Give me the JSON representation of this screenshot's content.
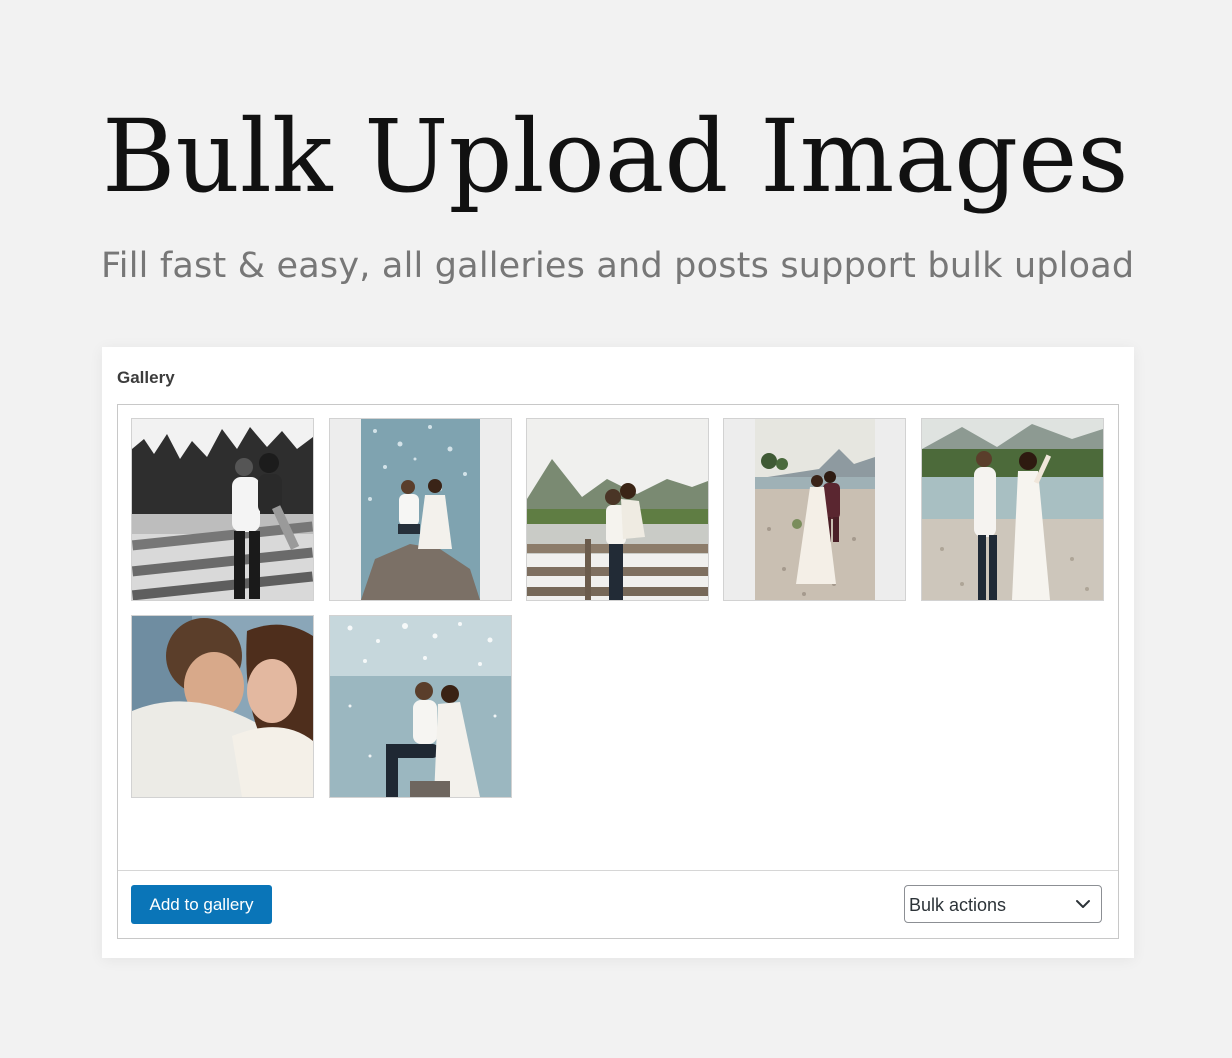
{
  "header": {
    "title": "Bulk Upload Images",
    "subtitle": "Fill fast & easy, all galleries and posts support bulk upload"
  },
  "gallery": {
    "title": "Gallery",
    "images": [
      {
        "alt": "couple piggyback on wooden fence, black and white"
      },
      {
        "alt": "couple sitting on rock by sparkling water"
      },
      {
        "alt": "couple kissing on wooden fence in mountains"
      },
      {
        "alt": "bride and groom walking on pebble beach"
      },
      {
        "alt": "couple dancing by mountain river"
      },
      {
        "alt": "couple close-up embrace"
      },
      {
        "alt": "couple sitting by sparkling lake"
      }
    ],
    "add_button": "Add to gallery",
    "bulk_actions": {
      "selected": "Bulk actions"
    }
  },
  "colors": {
    "background": "#f2f2f2",
    "primary_button": "#0a75b8"
  }
}
